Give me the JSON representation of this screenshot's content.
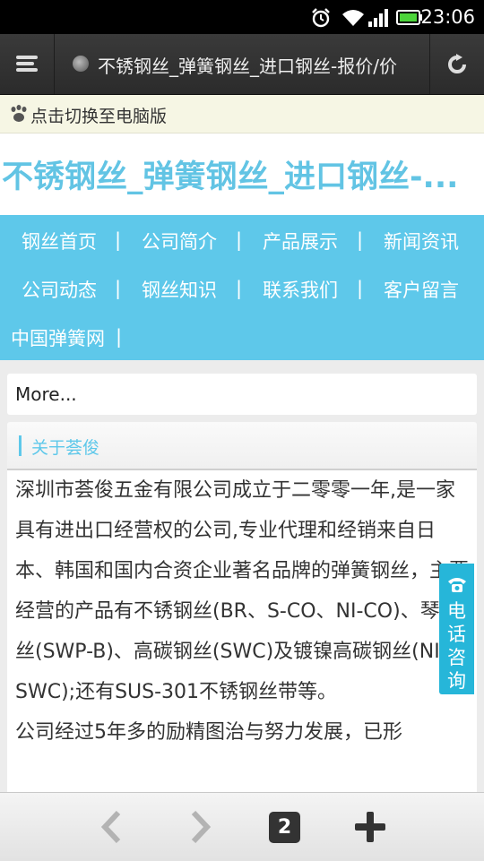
{
  "status_bar": {
    "time": "23:06"
  },
  "browser": {
    "menu_icon": "hamburger-icon",
    "url_title": "不锈钢丝_弹簧钢丝_进口钢丝-报价/价",
    "refresh_icon": "refresh-icon"
  },
  "pc_switch": {
    "label": "点击切换至电脑版"
  },
  "site": {
    "title": "不锈钢丝_弹簧钢丝_进口钢丝-..."
  },
  "nav": {
    "items": [
      {
        "label": "钢丝首页"
      },
      {
        "label": "公司简介"
      },
      {
        "label": "产品展示"
      },
      {
        "label": "新闻资讯"
      },
      {
        "label": "公司动态"
      },
      {
        "label": "钢丝知识"
      },
      {
        "label": "联系我们"
      },
      {
        "label": "客户留言"
      },
      {
        "label": "中国弹簧网"
      }
    ],
    "separator": "|"
  },
  "more": {
    "label": "More..."
  },
  "about": {
    "heading": "关于荟俊",
    "paragraphs": [
      "深圳市荟俊五金有限公司成立于二零零一年,是一家具有进出口经营权的公司,专业代理和经销来自日本、韩国和国内合资企业著名品牌的弹簧钢丝，主要经营的产品有不锈钢丝(BR、S-CO、NI-CO)、琴钢丝(SWP-B)、高碳钢丝(SWC)及镀镍高碳钢丝(NI-SWC);还有SUS-301不锈钢丝带等。",
      "公司经过5年多的励精图治与努力发展，已形"
    ]
  },
  "phone_consult": {
    "label": "电话咨询",
    "icon": "telephone-icon"
  },
  "bottom_bar": {
    "back_icon": "chevron-left-icon",
    "forward_icon": "chevron-right-icon",
    "tab_count": "2",
    "new_tab_icon": "plus-icon"
  },
  "colors": {
    "accent": "#5ec8ea",
    "title": "#62c4e4",
    "phone": "#26b6d9"
  }
}
